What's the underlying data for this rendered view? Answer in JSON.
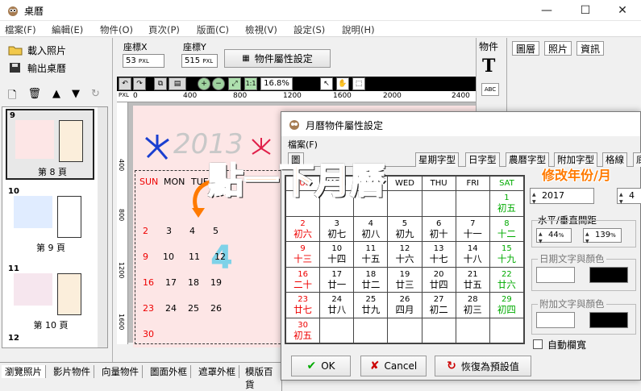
{
  "window": {
    "title": "桌曆",
    "minimize": "—",
    "maximize": "☐",
    "close": "✕"
  },
  "menu": [
    "檔案(F)",
    "編輯(E)",
    "物件(O)",
    "頁次(P)",
    "版面(C)",
    "檢視(V)",
    "設定(S)",
    "說明(H)"
  ],
  "left": {
    "load_photo": "載入照片",
    "export_calendar": "輸出桌曆",
    "pages": [
      {
        "num": "9",
        "label": "第 8 頁"
      },
      {
        "num": "10",
        "label": "第 9 頁"
      },
      {
        "num": "11",
        "label": "第 10 頁"
      },
      {
        "num": "12",
        "label": ""
      }
    ]
  },
  "toolbar": {
    "coord_x_label": "座標X",
    "coord_x_value": "53",
    "coord_y_label": "座標Y",
    "coord_y_value": "515",
    "unit": "PXL",
    "prop_button": "物件屬性設定",
    "zoom": "16.8%",
    "ruler_ticks": [
      "PXL",
      "0",
      "400",
      "800",
      "1200",
      "1600",
      "2000",
      "2400"
    ],
    "ruler_v_ticks": [
      "400",
      "800",
      "1200",
      "1600"
    ]
  },
  "canvas_preview": {
    "year": "2013",
    "month_big": "4",
    "weekdays": [
      "SUN",
      "MON",
      "TUE"
    ],
    "days": [
      [
        "2",
        "3",
        "4",
        "5"
      ],
      [
        "9",
        "10",
        "11",
        "12"
      ],
      [
        "16",
        "17",
        "18",
        "19"
      ],
      [
        "23",
        "24",
        "25",
        "26"
      ],
      [
        "30"
      ]
    ]
  },
  "object_panel": {
    "title": "物件",
    "text_icon": "T",
    "abc_icon": "ABC"
  },
  "right_tabs": [
    "圖層",
    "照片",
    "資訊"
  ],
  "bottom_tabs": [
    "瀏覽照片",
    "影片物件",
    "向量物件",
    "圖面外框",
    "遮罩外框",
    "模版百貨"
  ],
  "dialog": {
    "title": "月曆物件屬性設定",
    "menu": "檔案(F)",
    "tabs": [
      "圖",
      "",
      "",
      "星期字型",
      "日字型",
      "農曆字型",
      "附加字型",
      "格線",
      "底"
    ],
    "weekdays": [
      "SUN",
      "MON",
      "TUE",
      "WED",
      "THU",
      "FRI",
      "SAT"
    ],
    "rows": [
      [
        null,
        null,
        null,
        null,
        null,
        null,
        {
          "d": "1",
          "l": "初五"
        }
      ],
      [
        {
          "d": "2",
          "l": "初六"
        },
        {
          "d": "3",
          "l": "初七"
        },
        {
          "d": "4",
          "l": "初八"
        },
        {
          "d": "5",
          "l": "初九"
        },
        {
          "d": "6",
          "l": "初十"
        },
        {
          "d": "7",
          "l": "十一"
        },
        {
          "d": "8",
          "l": "十二"
        }
      ],
      [
        {
          "d": "9",
          "l": "十三"
        },
        {
          "d": "10",
          "l": "十四"
        },
        {
          "d": "11",
          "l": "十五"
        },
        {
          "d": "12",
          "l": "十六"
        },
        {
          "d": "13",
          "l": "十七"
        },
        {
          "d": "14",
          "l": "十八"
        },
        {
          "d": "15",
          "l": "十九"
        }
      ],
      [
        {
          "d": "16",
          "l": "二十"
        },
        {
          "d": "17",
          "l": "廿一"
        },
        {
          "d": "18",
          "l": "廿二"
        },
        {
          "d": "19",
          "l": "廿三"
        },
        {
          "d": "20",
          "l": "廿四"
        },
        {
          "d": "21",
          "l": "廿五"
        },
        {
          "d": "22",
          "l": "廿六"
        }
      ],
      [
        {
          "d": "23",
          "l": "廿七"
        },
        {
          "d": "24",
          "l": "廿八"
        },
        {
          "d": "25",
          "l": "廿九"
        },
        {
          "d": "26",
          "l": "四月"
        },
        {
          "d": "27",
          "l": "初二"
        },
        {
          "d": "28",
          "l": "初三"
        },
        {
          "d": "29",
          "l": "初四"
        }
      ],
      [
        {
          "d": "30",
          "l": "初五"
        },
        null,
        null,
        null,
        null,
        null,
        null
      ]
    ],
    "year_value": "2017",
    "month_value": "4",
    "spacing_label": "水平/垂直間距",
    "h_spacing": "44",
    "v_spacing": "139",
    "spacing_unit": "%",
    "date_color_label": "日期文字與顏色",
    "extra_color_label": "附加文字與顏色",
    "auto_width_label": "自動欄寬",
    "ok": "OK",
    "cancel": "Cancel",
    "reset": "恢復為預設值"
  },
  "annotations": {
    "main": "點一下月曆",
    "side": "修改年份/月"
  },
  "colors": {
    "sun": "#e00000",
    "sat": "#00aa00",
    "accent": "#ff7a00"
  }
}
